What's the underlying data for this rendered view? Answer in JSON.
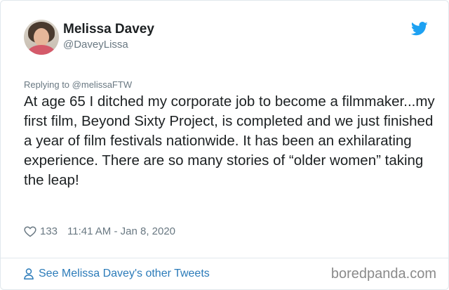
{
  "author": {
    "name": "Melissa Davey",
    "handle": "@DaveyLissa"
  },
  "reply_to": {
    "prefix": "Replying to",
    "handle": "@melissaFTW"
  },
  "tweet": {
    "text": "At age 65 I ditched my corporate job to become a filmmaker...my first film, Beyond Sixty Project, is completed and we just finished a year of film festivals nationwide. It has been an exhilarating experience. There are so many stories of “older women” taking the leap!",
    "likes": "133",
    "timestamp": "11:41 AM - Jan 8, 2020"
  },
  "footer": {
    "see_more": "See Melissa Davey's other Tweets",
    "watermark": "boredpanda.com"
  },
  "colors": {
    "link_blue": "#2b7bb9",
    "twitter_blue": "#1da1f2",
    "muted_gray": "#697882",
    "border": "#e1e8ed"
  },
  "icons": {
    "brand": "twitter-bird-icon",
    "like": "heart-icon",
    "profile": "person-icon"
  }
}
